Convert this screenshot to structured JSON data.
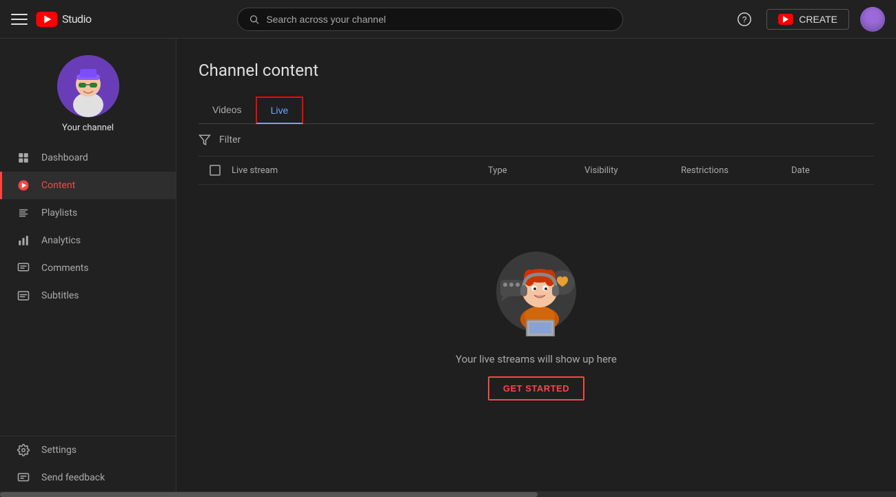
{
  "header": {
    "menu_icon": "☰",
    "logo_text": "Studio",
    "search_placeholder": "Search across your channel",
    "help_icon": "?",
    "create_label": "CREATE",
    "avatar_alt": "User avatar"
  },
  "sidebar": {
    "channel_label": "Your channel",
    "nav_items": [
      {
        "id": "dashboard",
        "label": "Dashboard",
        "icon": "⊞",
        "active": false
      },
      {
        "id": "content",
        "label": "Content",
        "icon": "▶",
        "active": true
      },
      {
        "id": "playlists",
        "label": "Playlists",
        "icon": "≡",
        "active": false
      },
      {
        "id": "analytics",
        "label": "Analytics",
        "icon": "📊",
        "active": false
      },
      {
        "id": "comments",
        "label": "Comments",
        "icon": "💬",
        "active": false
      },
      {
        "id": "subtitles",
        "label": "Subtitles",
        "icon": "⊟",
        "active": false
      }
    ],
    "bottom_items": [
      {
        "id": "settings",
        "label": "Settings",
        "icon": "⚙",
        "active": false
      },
      {
        "id": "feedback",
        "label": "Send feedback",
        "icon": "💬",
        "active": false
      }
    ]
  },
  "main": {
    "page_title": "Channel content",
    "tabs": [
      {
        "id": "videos",
        "label": "Videos",
        "active": false
      },
      {
        "id": "live",
        "label": "Live",
        "active": true
      }
    ],
    "filter_label": "Filter",
    "table_columns": {
      "live_stream": "Live stream",
      "type": "Type",
      "visibility": "Visibility",
      "restrictions": "Restrictions",
      "date": "Date"
    },
    "empty_state": {
      "message": "Your live streams will show up here",
      "cta_label": "GET STARTED"
    }
  }
}
